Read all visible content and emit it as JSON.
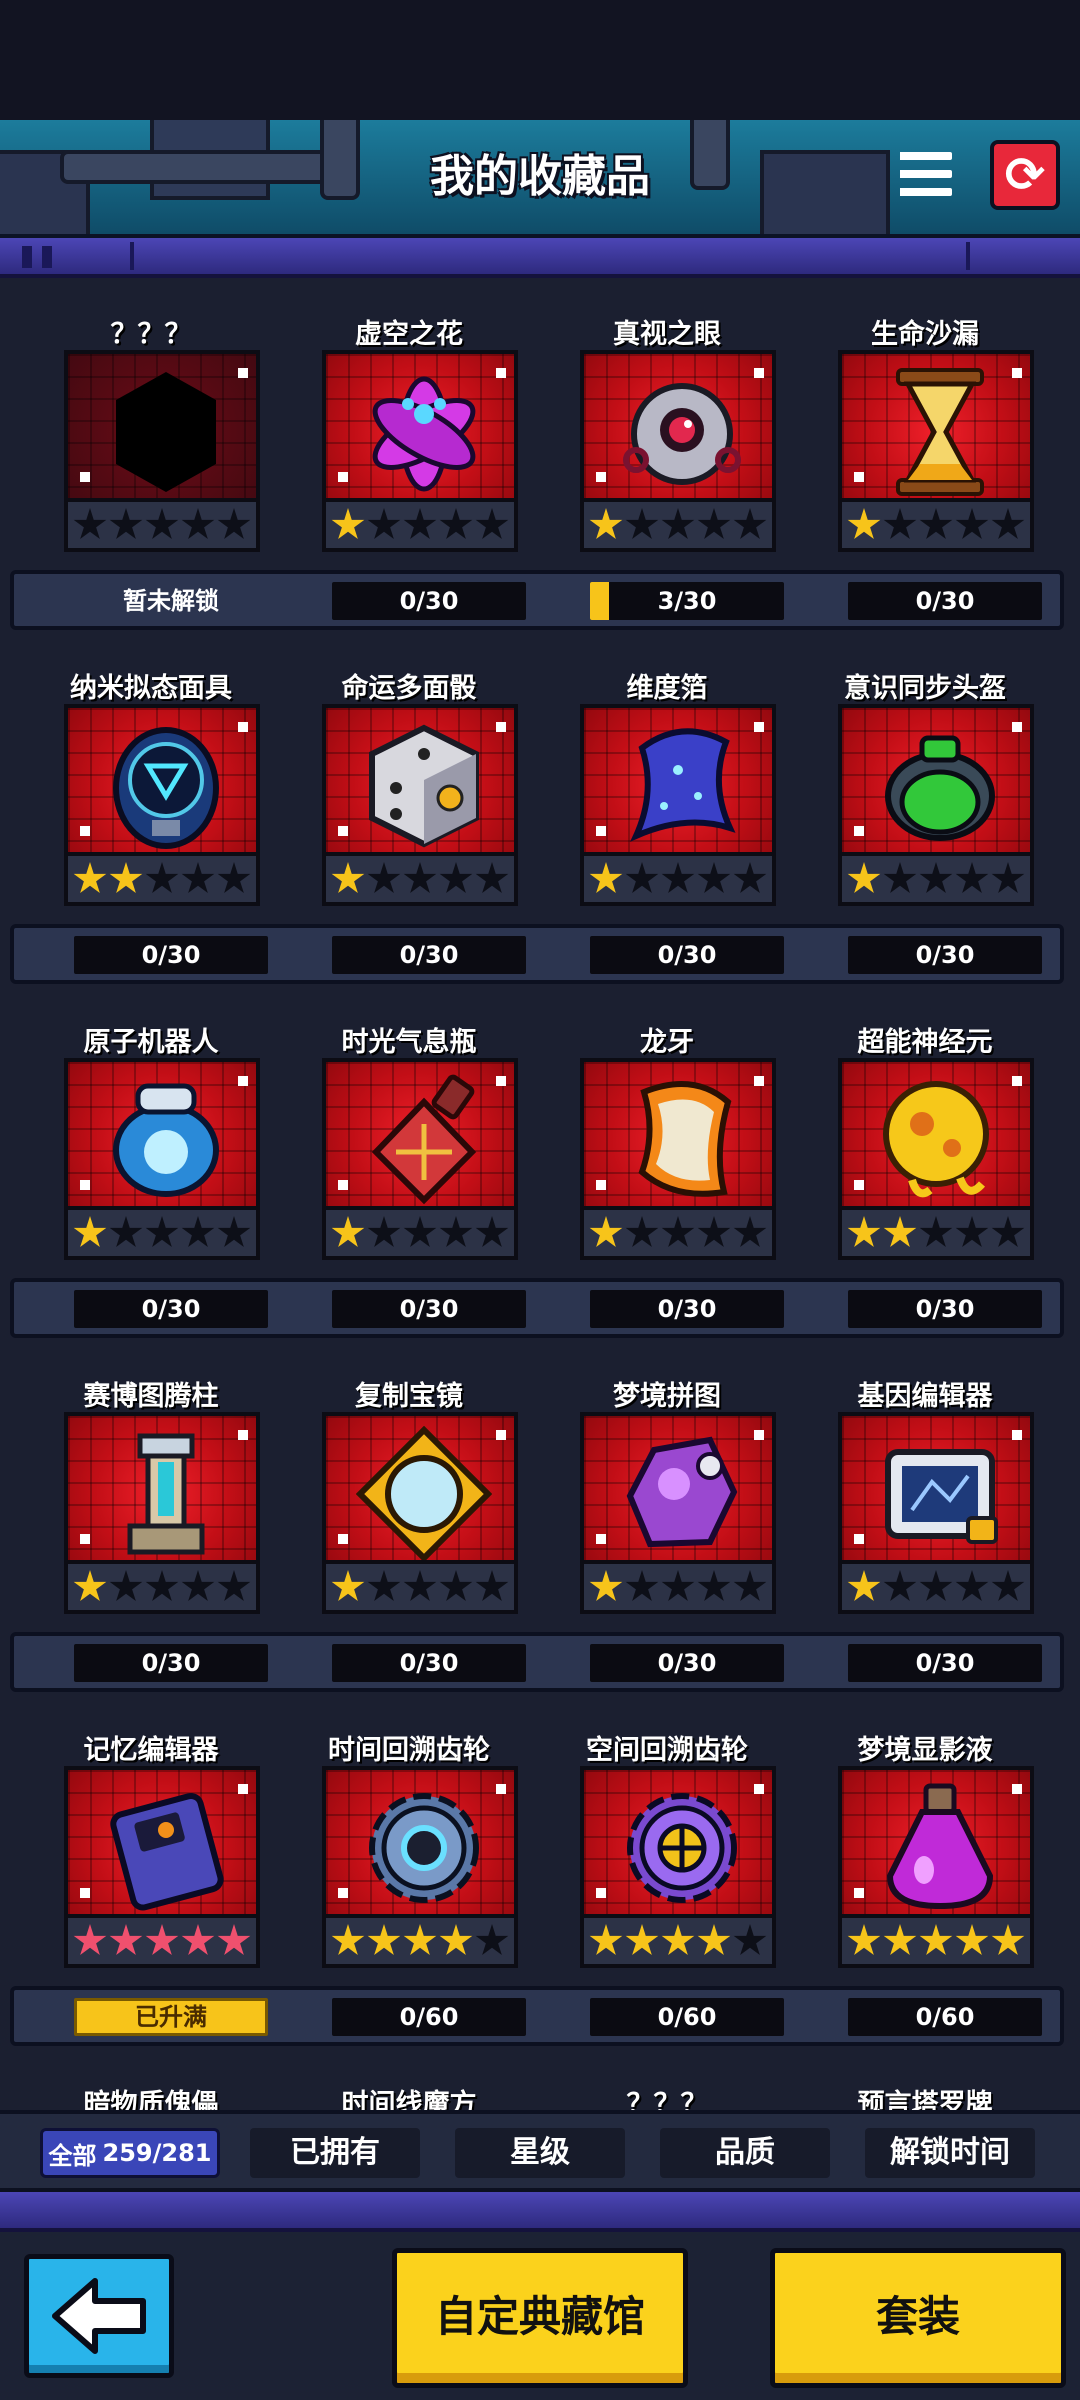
{
  "header": {
    "title": "我的收藏品"
  },
  "colors": {
    "accent": "#f7c41a",
    "card_red": "#c20e16",
    "back_button": "#29b4ea",
    "band_purple": "#4c46b6"
  },
  "items": [
    {
      "name": "？？？",
      "stars": 0,
      "star_color": "gold",
      "progress": "暂未解锁",
      "fill": 0,
      "icon": "locked-silhouette-icon",
      "locked": true
    },
    {
      "name": "虚空之花",
      "stars": 1,
      "star_color": "gold",
      "progress": "0/30",
      "fill": 0,
      "icon": "void-flower-icon"
    },
    {
      "name": "真视之眼",
      "stars": 1,
      "star_color": "gold",
      "progress": "3/30",
      "fill": 0.1,
      "icon": "true-sight-eye-icon"
    },
    {
      "name": "生命沙漏",
      "stars": 1,
      "star_color": "gold",
      "progress": "0/30",
      "fill": 0,
      "icon": "hourglass-icon"
    },
    {
      "name": "纳米拟态面具",
      "stars": 2,
      "star_color": "gold",
      "progress": "0/30",
      "fill": 0,
      "icon": "nano-mask-icon"
    },
    {
      "name": "命运多面骰",
      "stars": 1,
      "star_color": "gold",
      "progress": "0/30",
      "fill": 0,
      "icon": "dice-icon"
    },
    {
      "name": "维度箔",
      "stars": 1,
      "star_color": "gold",
      "progress": "0/30",
      "fill": 0,
      "icon": "dimension-foil-icon"
    },
    {
      "name": "意识同步头盔",
      "stars": 1,
      "star_color": "gold",
      "progress": "0/30",
      "fill": 0,
      "icon": "sync-helmet-icon"
    },
    {
      "name": "原子机器人",
      "stars": 1,
      "star_color": "gold",
      "progress": "0/30",
      "fill": 0,
      "icon": "atom-robot-icon"
    },
    {
      "name": "时光气息瓶",
      "stars": 1,
      "star_color": "gold",
      "progress": "0/30",
      "fill": 0,
      "icon": "time-bottle-icon"
    },
    {
      "name": "龙牙",
      "stars": 1,
      "star_color": "gold",
      "progress": "0/30",
      "fill": 0,
      "icon": "dragon-tooth-icon"
    },
    {
      "name": "超能神经元",
      "stars": 2,
      "star_color": "gold",
      "progress": "0/30",
      "fill": 0,
      "icon": "neuron-icon"
    },
    {
      "name": "赛博图腾柱",
      "stars": 1,
      "star_color": "gold",
      "progress": "0/30",
      "fill": 0,
      "icon": "cyber-totem-icon"
    },
    {
      "name": "复制宝镜",
      "stars": 1,
      "star_color": "gold",
      "progress": "0/30",
      "fill": 0,
      "icon": "mirror-icon"
    },
    {
      "name": "梦境拼图",
      "stars": 1,
      "star_color": "gold",
      "progress": "0/30",
      "fill": 0,
      "icon": "puzzle-icon"
    },
    {
      "name": "基因编辑器",
      "stars": 1,
      "star_color": "gold",
      "progress": "0/30",
      "fill": 0,
      "icon": "gene-editor-icon"
    },
    {
      "name": "记忆编辑器",
      "stars": 5,
      "star_color": "pink",
      "progress": "已升满",
      "fill": 1,
      "icon": "memory-editor-icon",
      "maxed": true
    },
    {
      "name": "时间回溯齿轮",
      "stars": 4,
      "star_color": "gold",
      "progress": "0/60",
      "fill": 0,
      "icon": "time-gear-icon"
    },
    {
      "name": "空间回溯齿轮",
      "stars": 4,
      "star_color": "gold",
      "progress": "0/60",
      "fill": 0,
      "icon": "space-gear-icon"
    },
    {
      "name": "梦境显影液",
      "stars": 5,
      "star_color": "gold",
      "progress": "0/60",
      "fill": 0,
      "icon": "potion-icon"
    },
    {
      "name": "暗物质傀儡",
      "icon": "",
      "partial": true
    },
    {
      "name": "时间线魔方",
      "icon": "",
      "partial": true
    },
    {
      "name": "？？？",
      "icon": "",
      "partial": true
    },
    {
      "name": "预言塔罗牌",
      "icon": "",
      "partial": true
    }
  ],
  "filters": {
    "all_label": "全部",
    "all_count": "259/281",
    "owned": "已拥有",
    "stars": "星级",
    "quality": "品质",
    "unlock_time": "解锁时间"
  },
  "bottom": {
    "custom_museum": "自定典藏馆",
    "sets": "套装"
  }
}
